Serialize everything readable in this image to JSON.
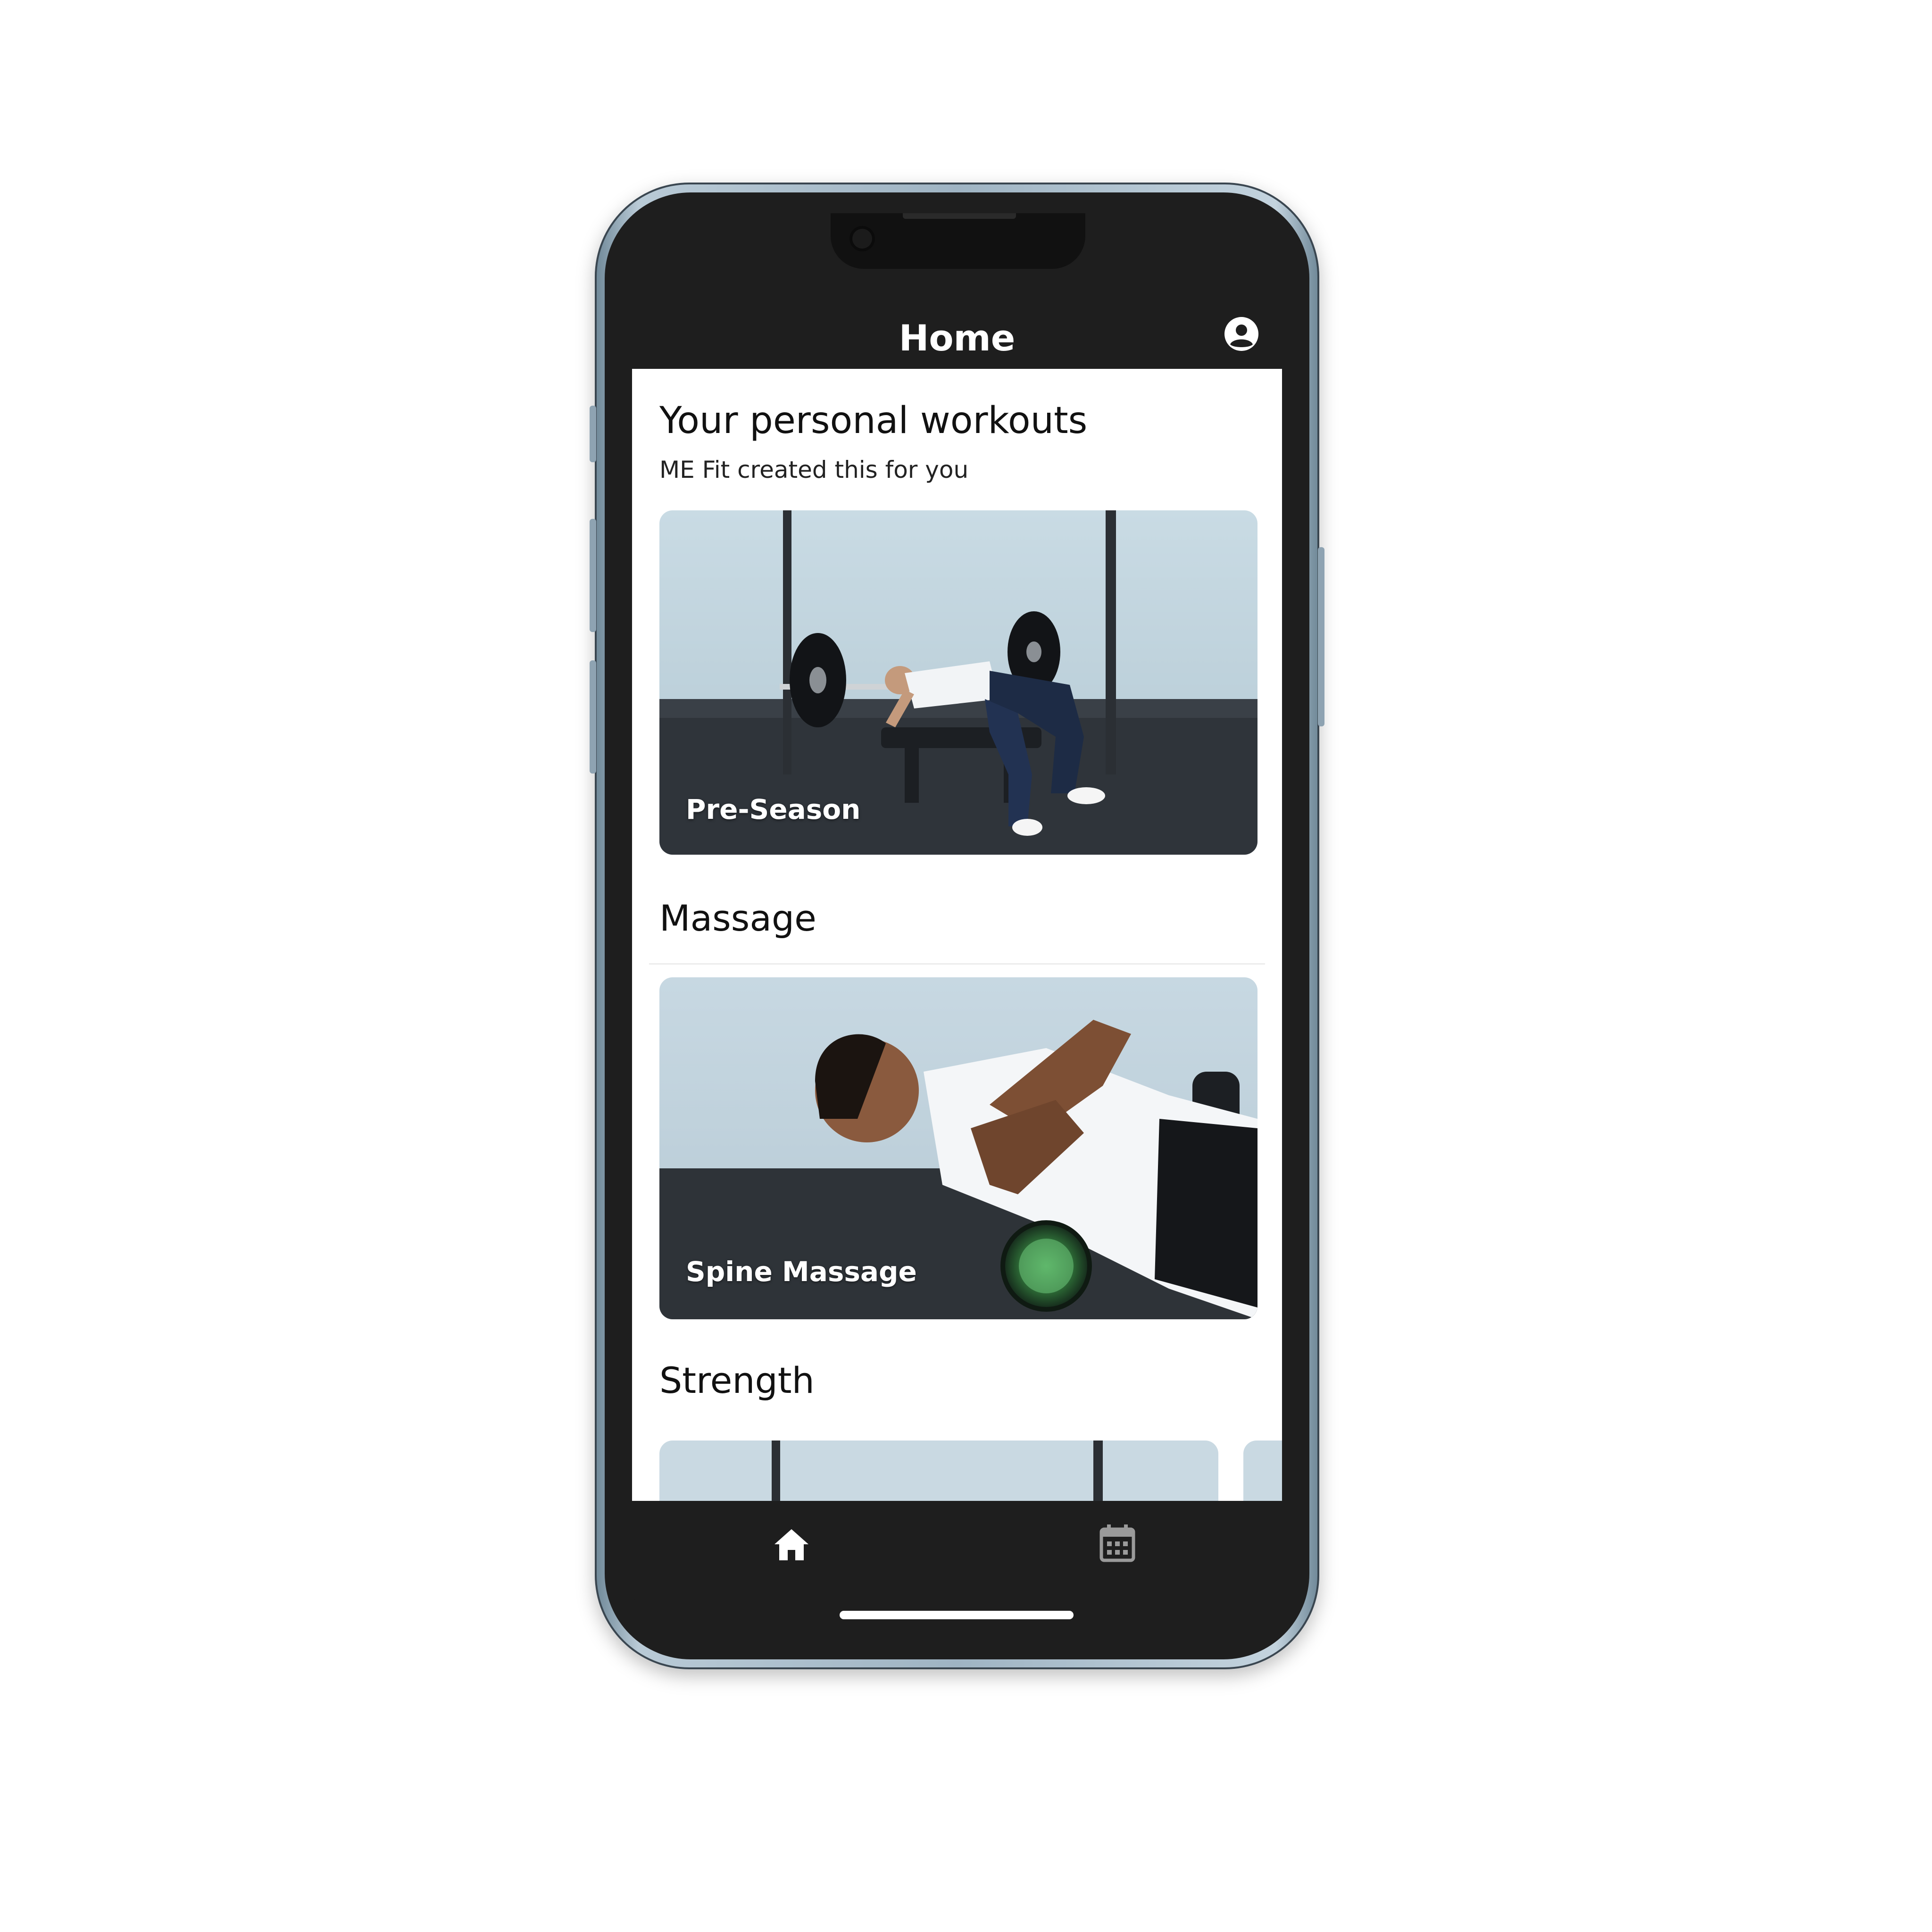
{
  "header": {
    "title": "Home",
    "profile_icon": "account-circle-icon"
  },
  "personal": {
    "heading": "Your personal workouts",
    "subheading": "ME Fit created this for you",
    "card": {
      "label": "Pre-Season"
    }
  },
  "massage": {
    "heading": "Massage",
    "card": {
      "label": "Spine Massage"
    }
  },
  "strength": {
    "heading": "Strength"
  },
  "bottom_nav": {
    "items": [
      {
        "icon": "home-icon",
        "active": true
      },
      {
        "icon": "calendar-icon",
        "active": false
      }
    ]
  },
  "colors": {
    "app_bar": "#1e1e1e",
    "content_bg": "#ffffff",
    "text": "#111111",
    "card_label": "#ffffff"
  }
}
